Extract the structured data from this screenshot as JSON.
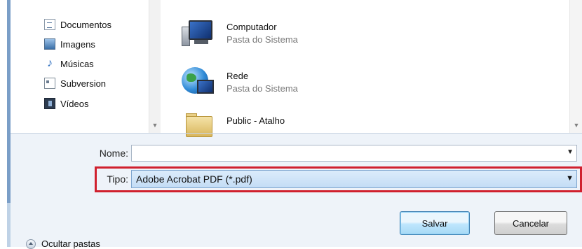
{
  "navigation": {
    "items": [
      {
        "label": "Documentos",
        "icon": "documents-icon"
      },
      {
        "label": "Imagens",
        "icon": "pictures-icon"
      },
      {
        "label": "Músicas",
        "icon": "music-icon"
      },
      {
        "label": "Subversion",
        "icon": "subversion-icon"
      },
      {
        "label": "Vídeos",
        "icon": "videos-icon"
      }
    ]
  },
  "files": [
    {
      "name": "Computador",
      "subtitle": "Pasta do Sistema",
      "icon": "computer-icon"
    },
    {
      "name": "Rede",
      "subtitle": "Pasta do Sistema",
      "icon": "network-icon"
    },
    {
      "name": "Public - Atalho",
      "subtitle": "",
      "icon": "folder-shortcut-icon"
    }
  ],
  "form": {
    "name_label": "Nome:",
    "name_value": "",
    "type_label": "Tipo:",
    "type_value": "Adobe Acrobat PDF  (*.pdf)"
  },
  "footer": {
    "toggle_folders_label": "Ocultar pastas",
    "save_label": "Salvar",
    "cancel_label": "Cancelar"
  },
  "colors": {
    "highlight_border": "#d0202e",
    "selected_dropdown": "#c3dcf5",
    "window_frame": "#7a9ec7"
  }
}
